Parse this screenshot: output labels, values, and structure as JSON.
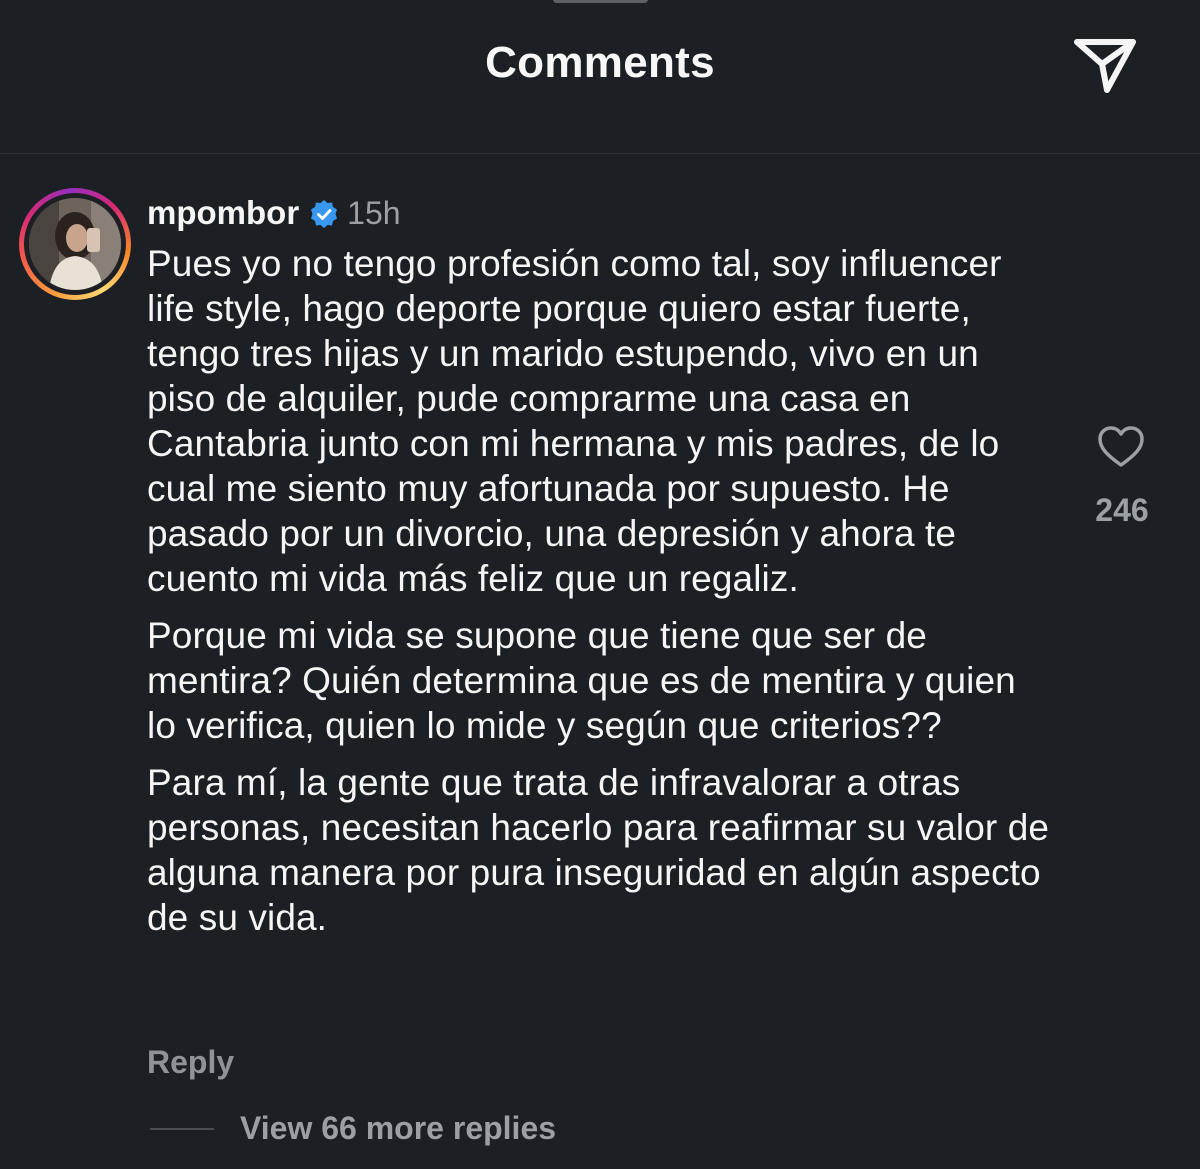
{
  "header": {
    "title": "Comments",
    "share_icon": "paper-plane-icon"
  },
  "comment": {
    "username": "mpombor",
    "verified": true,
    "verified_icon": "verified-badge-icon",
    "timestamp": "15h",
    "paragraphs": [
      "Pues yo no tengo profesión como tal, soy influencer life style, hago deporte porque quiero estar fuerte, tengo tres hijas y un marido estupendo, vivo en un piso de alquiler, pude comprarme una casa en Cantabria junto con mi hermana y mis padres, de lo cual me siento muy afortunada por supuesto. He pasado por un divorcio, una depresión y ahora te cuento mi vida más feliz que un regaliz.",
      "Porque mi vida se supone que tiene que ser de mentira? Quién determina que es de mentira y quien lo verifica, quien lo mide y según que criterios??",
      "Para mí, la gente que trata de infravalorar a otras personas, necesitan hacerlo para reafirmar su valor de alguna manera por pura inseguridad en algún aspecto de su vida."
    ],
    "like_icon": "heart-outline-icon",
    "like_count": "246",
    "reply_label": "Reply",
    "view_replies_label": "View 66 more replies"
  },
  "colors": {
    "background": "#1c1f23",
    "text_primary": "#f5f5f5",
    "text_secondary": "#9aa0a6",
    "verified_blue": "#3897f0",
    "divider": "#2e3238"
  }
}
